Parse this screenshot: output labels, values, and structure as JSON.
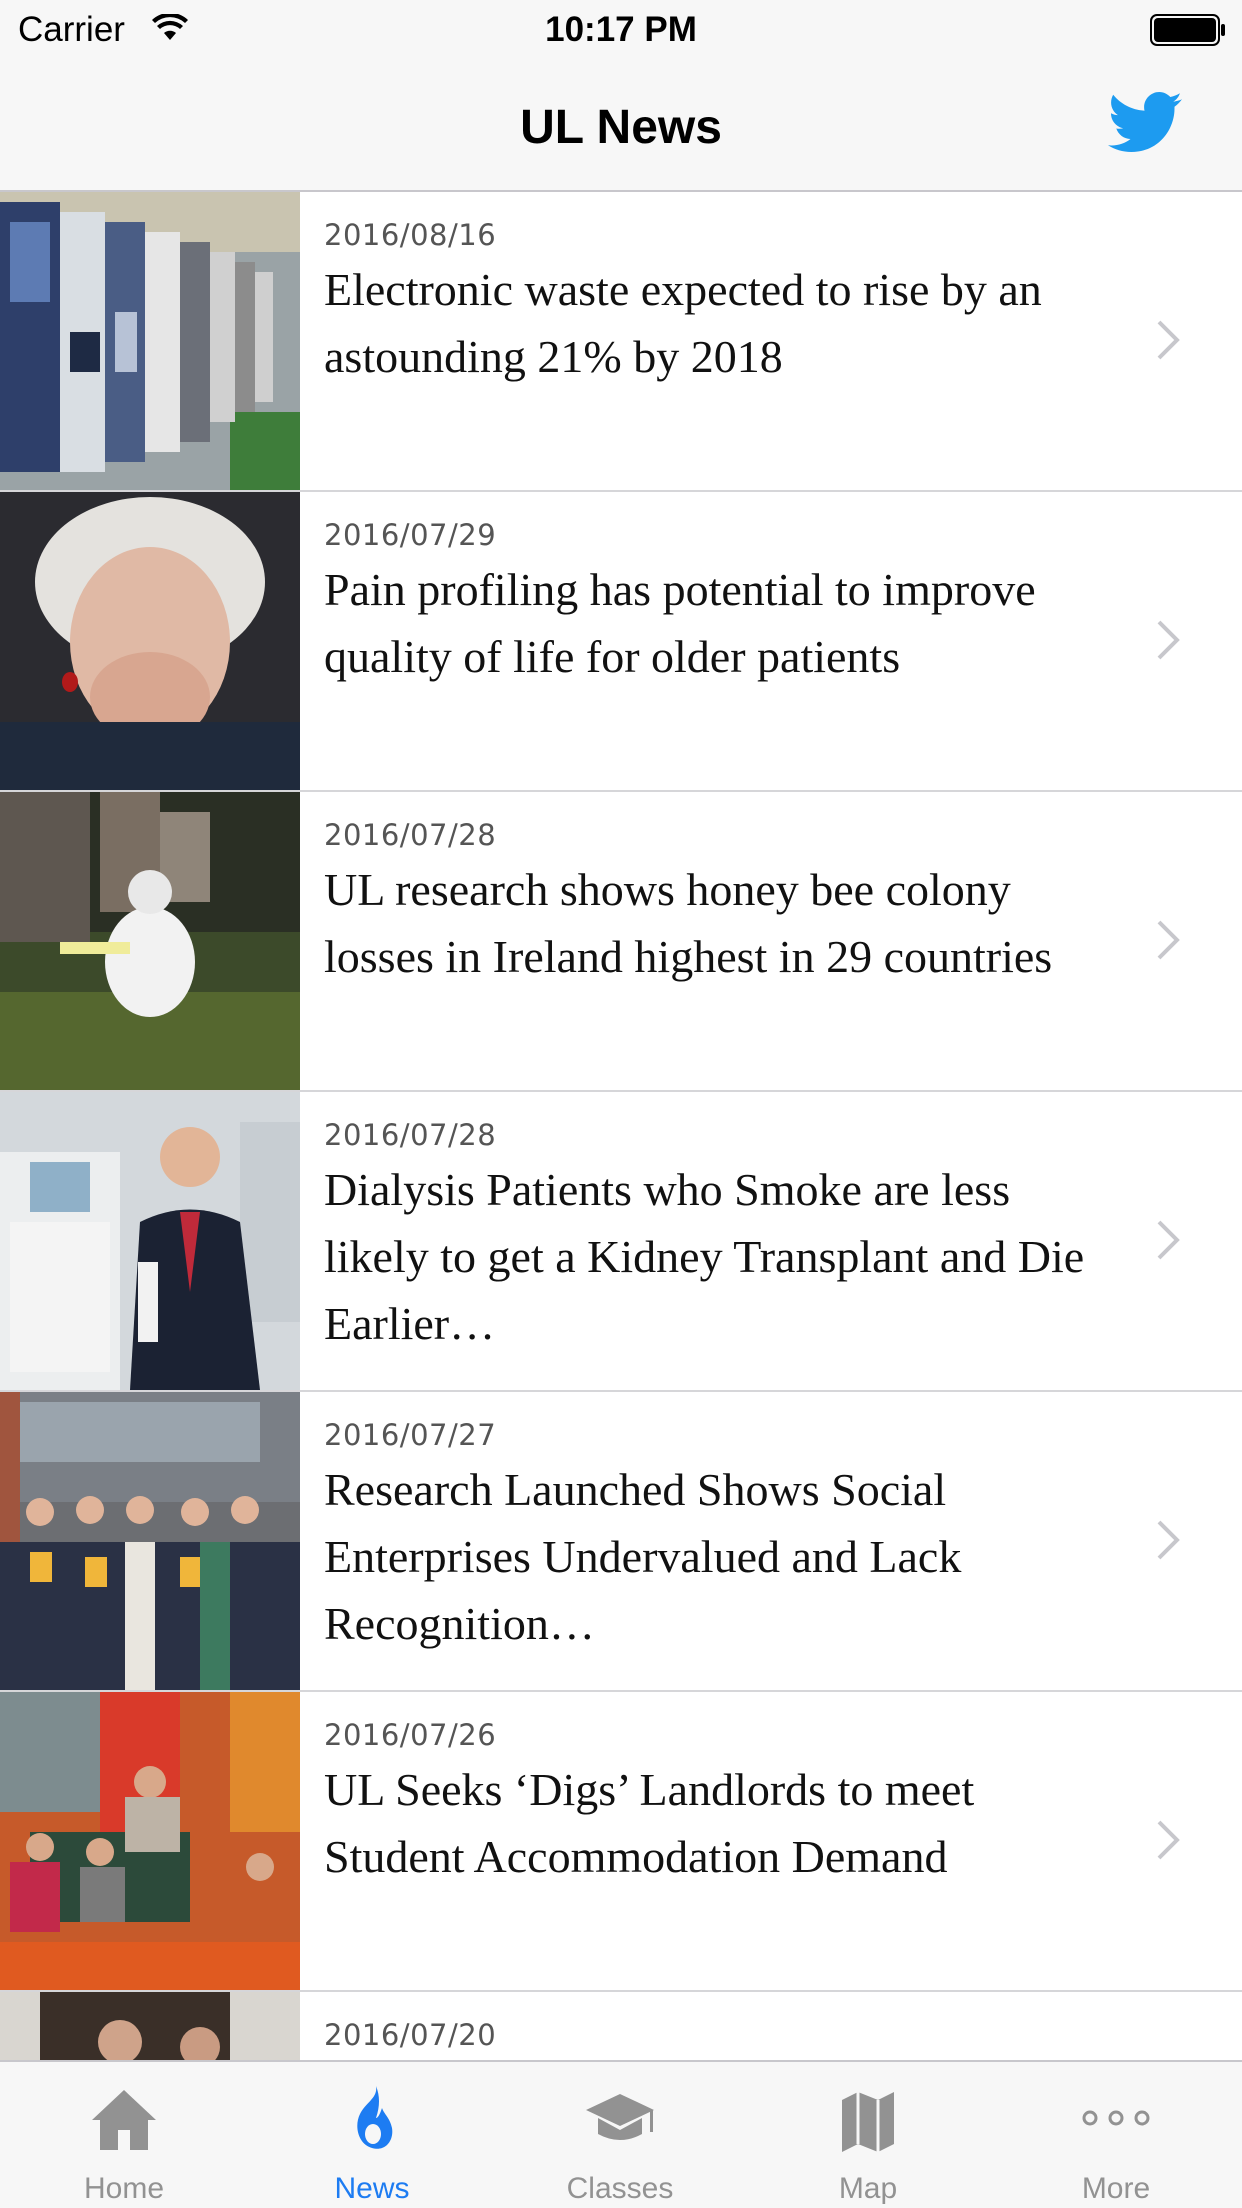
{
  "status_bar": {
    "carrier": "Carrier",
    "time": "10:17 PM"
  },
  "nav": {
    "title": "UL News",
    "twitter_icon": "twitter-bird-icon",
    "accent_color": "#1d9bf0"
  },
  "news": [
    {
      "date": "2016/08/16",
      "headline": "Electronic waste expected to rise by an astounding 21% by 2018"
    },
    {
      "date": "2016/07/29",
      "headline": "Pain profiling has potential to improve quality of life for older patients"
    },
    {
      "date": "2016/07/28",
      "headline": "UL research shows honey bee colony losses in Ireland highest in 29 countries"
    },
    {
      "date": "2016/07/28",
      "headline": "Dialysis Patients who Smoke are less likely to get a Kidney Transplant and Die Earlier…"
    },
    {
      "date": "2016/07/27",
      "headline": "Research Launched Shows Social Enterprises Undervalued and Lack Recognition…"
    },
    {
      "date": "2016/07/26",
      "headline": "UL Seeks ‘Digs’ Landlords to meet Student Accommodation Demand"
    },
    {
      "date": "2016/07/20",
      "headline": ""
    }
  ],
  "tabs": [
    {
      "label": "Home",
      "icon": "home-icon"
    },
    {
      "label": "News",
      "icon": "flame-icon",
      "active": true
    },
    {
      "label": "Classes",
      "icon": "graduation-cap-icon"
    },
    {
      "label": "Map",
      "icon": "map-icon"
    },
    {
      "label": "More",
      "icon": "more-dots-icon"
    }
  ],
  "colors": {
    "active_tab": "#1d7cf2",
    "inactive_tab": "#929292",
    "bar_background": "#f7f7f7"
  }
}
